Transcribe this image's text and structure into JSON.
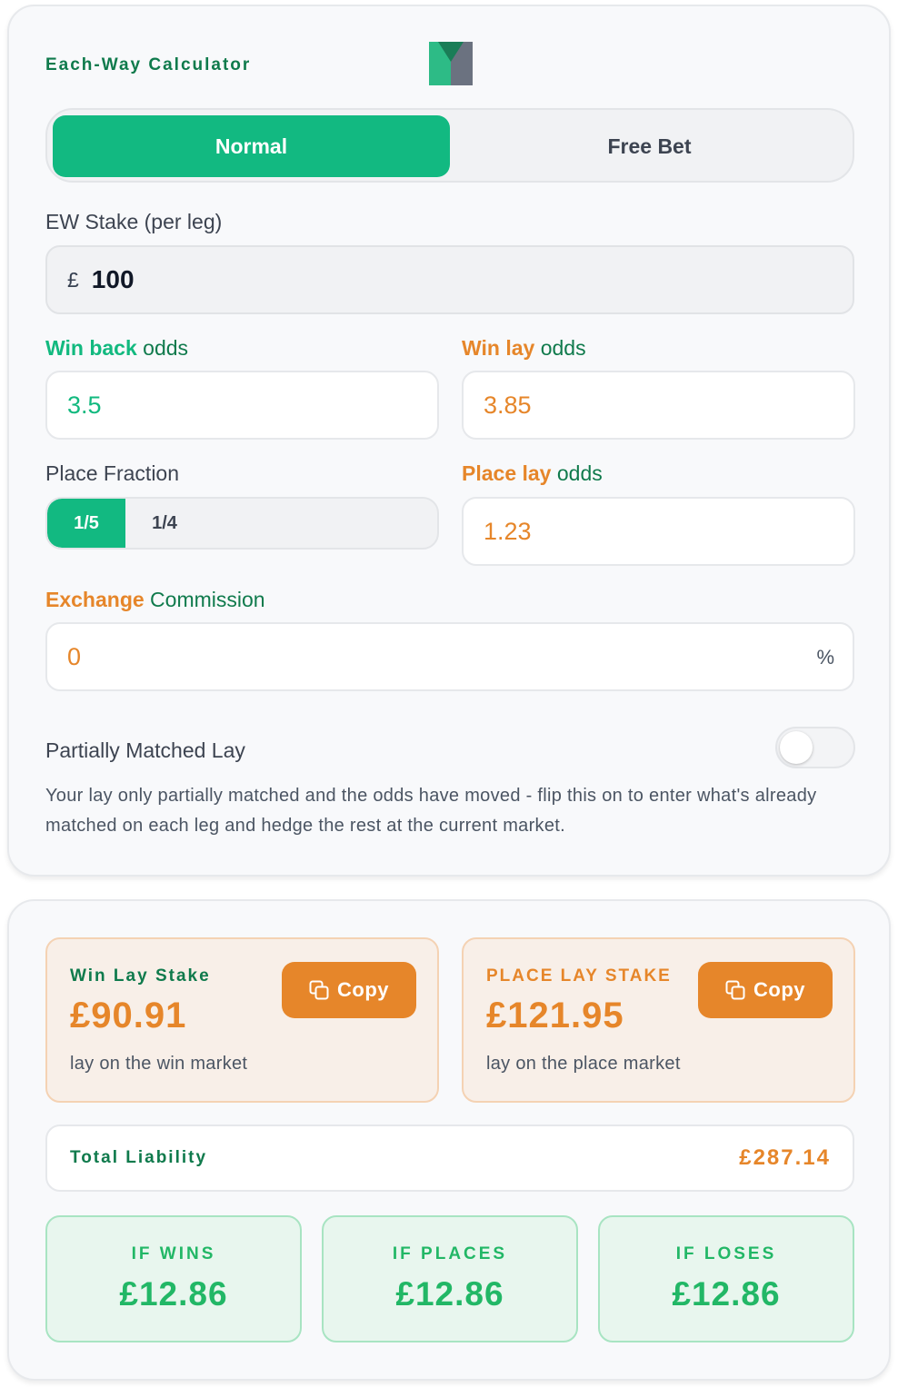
{
  "app": {
    "title": "Each-Way Calculator",
    "logo": "app-logo"
  },
  "mode": {
    "tabs": [
      {
        "label": "Normal",
        "active": true
      },
      {
        "label": "Free Bet",
        "active": false
      }
    ]
  },
  "stake": {
    "label": "EW Stake (per leg)",
    "currency": "£",
    "value": "100"
  },
  "win_back": {
    "label_a": "Win back",
    "label_b": " odds",
    "value": "3.5"
  },
  "win_lay": {
    "label_a": "Win lay",
    "label_b": " odds",
    "value": "3.85"
  },
  "place_fraction": {
    "label": "Place Fraction",
    "options": [
      "1/5",
      "1/4"
    ],
    "selected": "1/5"
  },
  "place_lay": {
    "label_a": "Place lay",
    "label_b": " odds",
    "value": "1.23"
  },
  "commission": {
    "label_a": "Exchange",
    "label_b": " Commission",
    "value": "0",
    "unit": "%"
  },
  "partial": {
    "label": "Partially Matched Lay",
    "enabled": false,
    "description": "Your lay only partially matched and the odds have moved - flip this on to enter what's already matched on each leg and hedge the rest at the current market."
  },
  "results": {
    "win_lay": {
      "title": "Win Lay Stake",
      "amount": "£90.91",
      "sub": "lay on the win market",
      "copy_label": "Copy"
    },
    "place_lay": {
      "title": "PLACE LAY STAKE",
      "amount": "£121.95",
      "sub": "lay on the place market",
      "copy_label": "Copy"
    },
    "liability": {
      "label": "Total Liability",
      "value": "£287.14"
    },
    "outcomes": [
      {
        "label": "IF WINS",
        "value": "£12.86"
      },
      {
        "label": "IF PLACES",
        "value": "£12.86"
      },
      {
        "label": "IF LOSES",
        "value": "£12.86"
      }
    ]
  },
  "colors": {
    "green": "#12b981",
    "orange": "#e6862a",
    "dark_green": "#0f7a4c",
    "profit_green": "#22b766"
  },
  "icons": [
    "copy-icon"
  ]
}
